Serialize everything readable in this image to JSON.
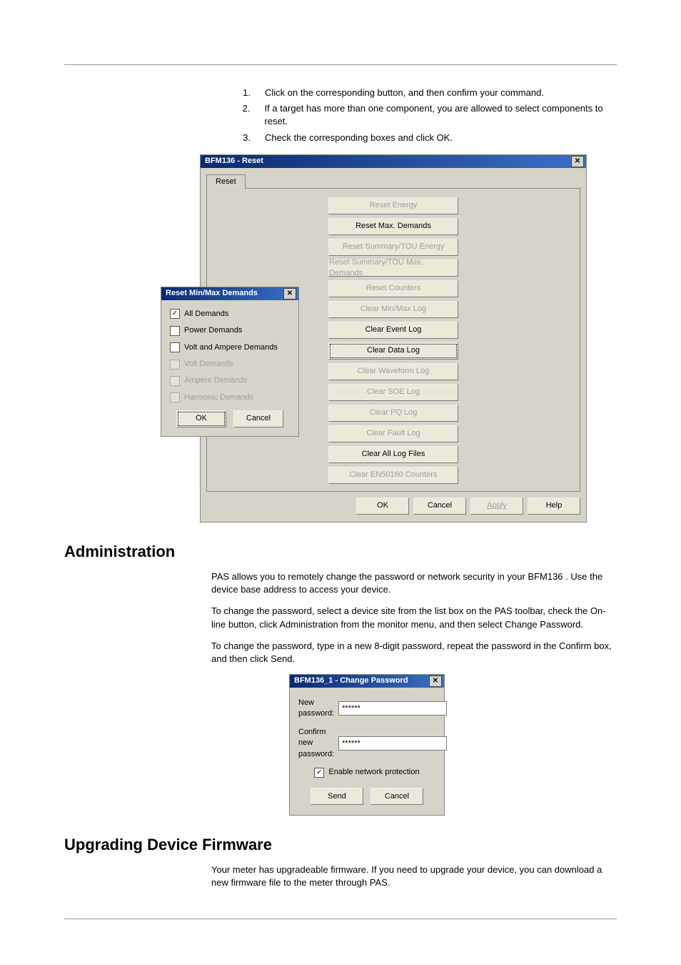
{
  "steps": {
    "items": [
      {
        "num": "1.",
        "text": "Click on the corresponding button, and then confirm your command."
      },
      {
        "num": "2.",
        "text": "If a target has more than one component, you are allowed to select components to reset."
      },
      {
        "num": "3.",
        "text": "Check the corresponding boxes and click OK."
      }
    ]
  },
  "reset_dialog": {
    "title": "BFM136 - Reset",
    "tab": "Reset",
    "buttons": [
      {
        "label": "Reset Energy",
        "enabled": false
      },
      {
        "label": "Reset Max. Demands",
        "enabled": true
      },
      {
        "label": "Reset Summary/TOU Energy",
        "enabled": false
      },
      {
        "label": "Reset Summary/TOU Max. Demands",
        "enabled": false
      },
      {
        "label": "Reset Counters",
        "enabled": false
      },
      {
        "label": "Clear Min/Max Log",
        "enabled": false
      },
      {
        "label": "Clear Event Log",
        "enabled": true
      },
      {
        "label": "Clear Data Log",
        "enabled": true,
        "focused": true
      },
      {
        "label": "Clear Waveform Log",
        "enabled": false
      },
      {
        "label": "Clear SOE Log",
        "enabled": false
      },
      {
        "label": "Clear PQ Log",
        "enabled": false
      },
      {
        "label": "Clear Fault Log",
        "enabled": false
      },
      {
        "label": "Clear All Log Files",
        "enabled": true
      },
      {
        "label": "Clear EN50160 Counters",
        "enabled": false
      }
    ],
    "bottom": {
      "ok": "OK",
      "cancel": "Cancel",
      "apply": "Apply",
      "help": "Help"
    }
  },
  "mini_dialog": {
    "title": "Reset Min/Max Demands",
    "options": [
      {
        "label": "All Demands",
        "checked": true,
        "enabled": true
      },
      {
        "label": "Power Demands",
        "checked": false,
        "enabled": true
      },
      {
        "label": "Volt and Ampere Demands",
        "checked": false,
        "enabled": true
      },
      {
        "label": "Volt Demands",
        "checked": false,
        "enabled": false
      },
      {
        "label": "Ampere Demands",
        "checked": false,
        "enabled": false
      },
      {
        "label": "Harmonic Demands",
        "checked": false,
        "enabled": false
      }
    ],
    "ok": "OK",
    "cancel": "Cancel"
  },
  "admin": {
    "heading": "Administration",
    "p1": "PAS allows you to remotely change the password or network security in your BFM136 . Use the device base address to access your device.",
    "p2": "To change the password, select a device site from the list box on the PAS toolbar, check the On-line button, click Administration from the monitor menu, and then select Change Password.",
    "p3": "To change the password, type in a new 8-digit password, repeat the password in the Confirm box, and then click Send."
  },
  "pw_dialog": {
    "title": "BFM136_1 - Change Password",
    "new_label": "New password:",
    "confirm_label": "Confirm new password:",
    "new_value": "******",
    "confirm_value": "******",
    "enable_label": "Enable network protection",
    "enable_checked": true,
    "send": "Send",
    "cancel": "Cancel"
  },
  "upgrade": {
    "heading": "Upgrading Device Firmware",
    "p1": "Your meter has upgradeable firmware. If you need to upgrade your device, you can download a new firmware file to the meter through PAS."
  }
}
